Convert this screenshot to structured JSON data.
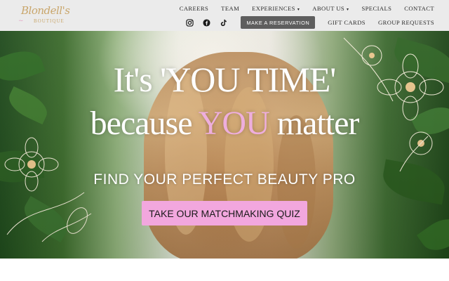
{
  "logo": {
    "name_text": "Blondell's",
    "sub_text": "BOUTIQUE"
  },
  "nav": {
    "items": [
      {
        "label": "CAREERS",
        "has_dropdown": false
      },
      {
        "label": "TEAM",
        "has_dropdown": false
      },
      {
        "label": "EXPERIENCES",
        "has_dropdown": true
      },
      {
        "label": "ABOUT US",
        "has_dropdown": true
      },
      {
        "label": "SPECIALS",
        "has_dropdown": false
      },
      {
        "label": "CONTACT",
        "has_dropdown": false
      }
    ],
    "dropdown_glyph": "▾",
    "reserve_label": "MAKE A RESERVATION",
    "gift_cards_label": "GIFT CARDS",
    "group_requests_label": "GROUP REQUESTS",
    "social_icons": [
      "instagram-icon",
      "facebook-icon",
      "tiktok-icon"
    ]
  },
  "hero": {
    "headline_line1": "It's 'YOU TIME'",
    "headline_line2_start": "because ",
    "headline_line2_highlight": "YOU",
    "headline_line2_end": " matter",
    "subheadline": "FIND YOUR PERFECT BEAUTY PRO",
    "cta_label": "TAKE OUR MATCHMAKING QUIZ"
  },
  "colors": {
    "header_bg": "#ebebeb",
    "reserve_button_bg": "#5e5e5e",
    "cta_bg": "#f2a7de",
    "highlight_pink": "#eeaedd",
    "logo_gold": "#c9a66b"
  }
}
